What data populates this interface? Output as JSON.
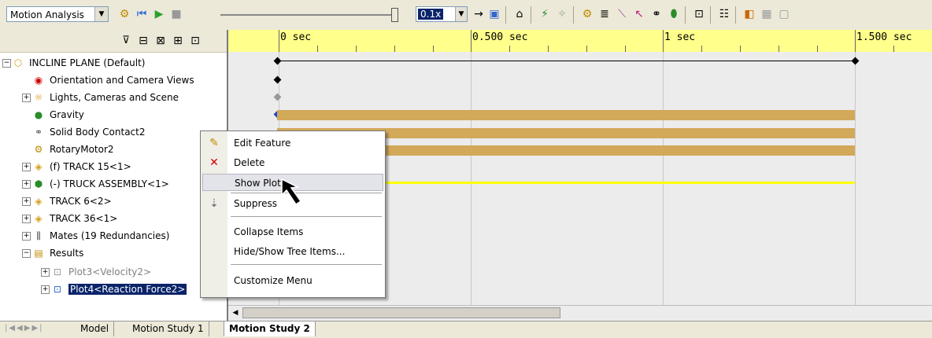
{
  "toolbar": {
    "mode_value": "Motion Analysis",
    "speed_value": "0.1x"
  },
  "tree": {
    "root": "INCLINE PLANE  (Default)",
    "items": [
      "Orientation and Camera Views",
      "Lights, Cameras and Scene",
      "Gravity",
      "Solid Body Contact2",
      "RotaryMotor2",
      "(f) TRACK 15<1>",
      "(-) TRUCK ASSEMBLY<1>",
      "TRACK 6<2>",
      "TRACK 36<1>",
      "Mates (19 Redundancies)",
      "Results",
      "Plot3<Velocity2>",
      "Plot4<Reaction Force2>"
    ]
  },
  "timeline": {
    "labels": [
      "0 sec",
      "0.500 sec",
      "1 sec",
      "1.500 sec"
    ]
  },
  "context_menu": {
    "items": [
      "Edit Feature",
      "Delete",
      "Show Plot",
      "Suppress",
      "Collapse Items",
      "Hide/Show Tree Items...",
      "Customize Menu"
    ]
  },
  "tabs": [
    "Model",
    "Motion Study 1",
    "Motion Study 2"
  ],
  "colors": {
    "ruler": "#ffff8c",
    "bar": "#d2a859",
    "selection": "#0a246a",
    "plot_line": "#ffff00"
  }
}
